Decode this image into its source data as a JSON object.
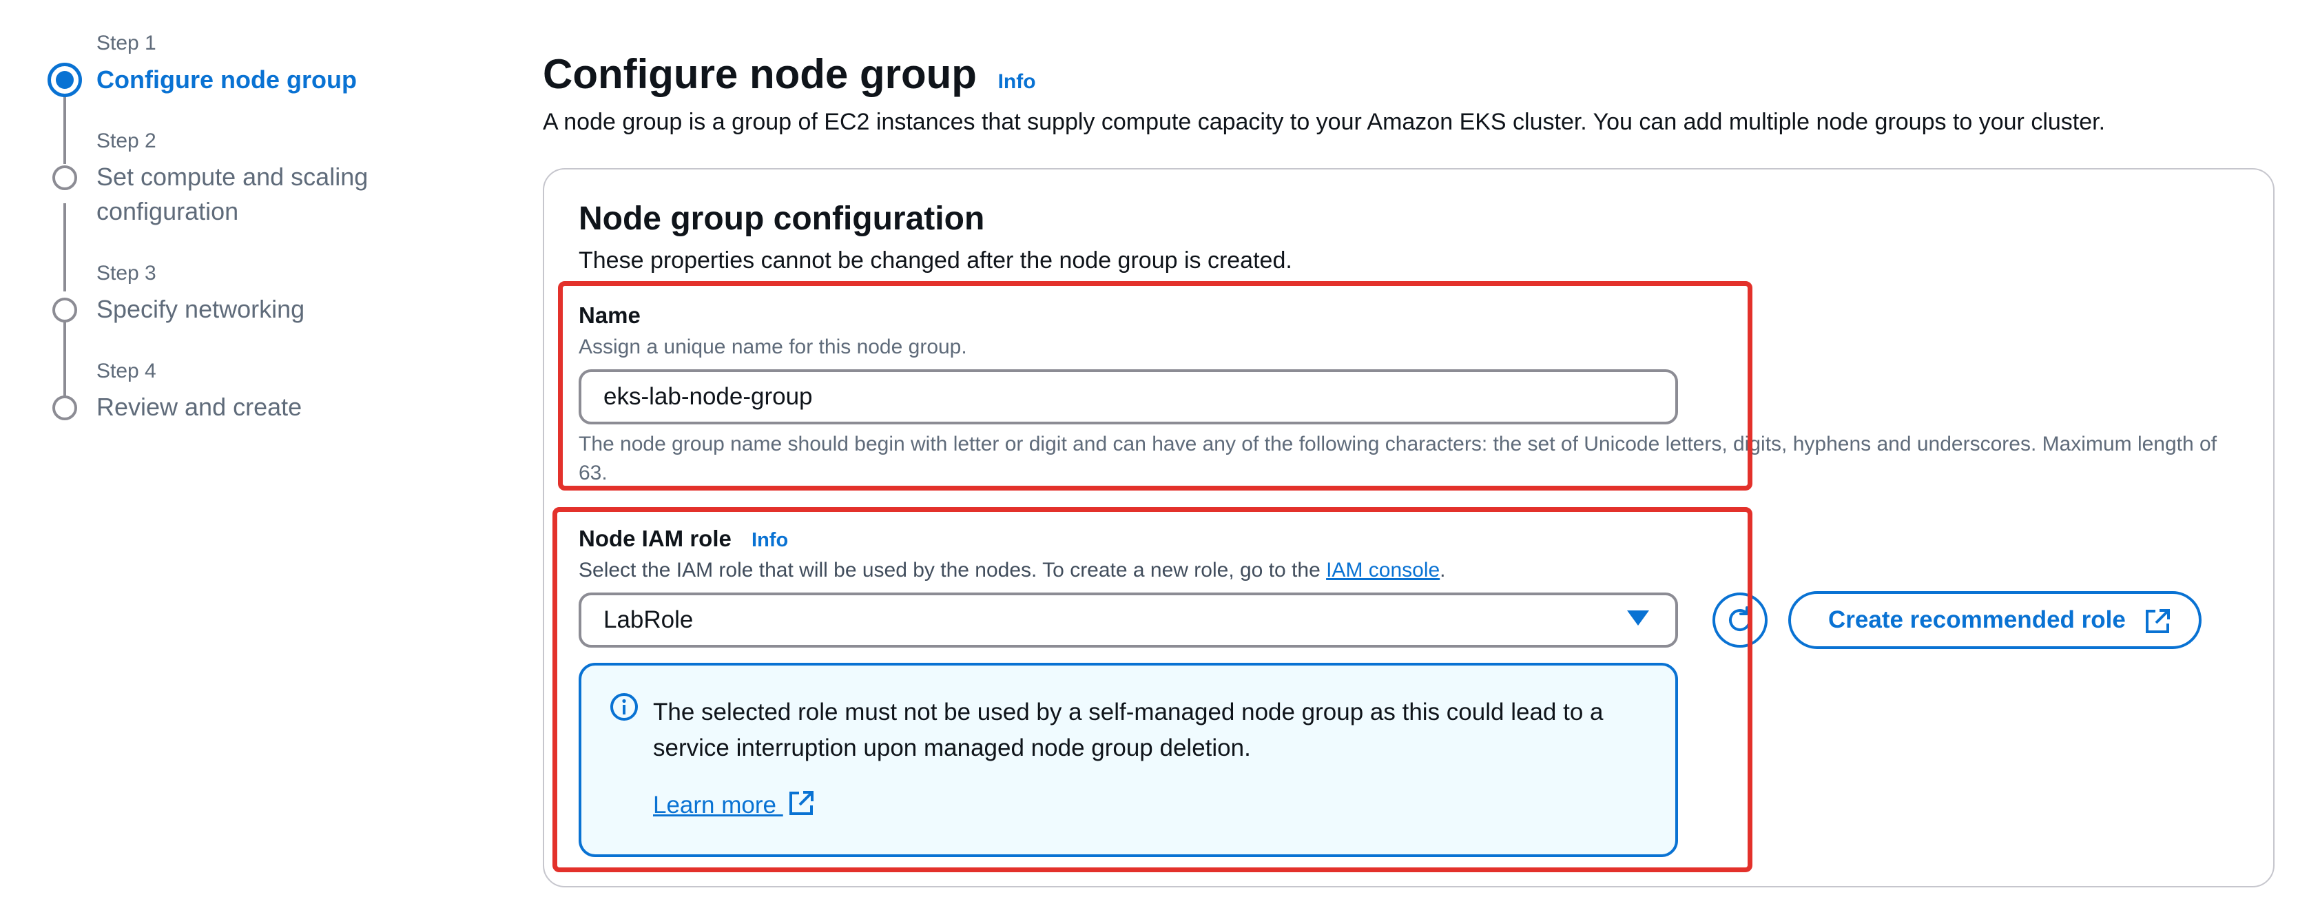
{
  "steps": [
    {
      "label": "Step 1",
      "title": "Configure node group",
      "active": true
    },
    {
      "label": "Step 2",
      "title": "Set compute and scaling configuration",
      "active": false
    },
    {
      "label": "Step 3",
      "title": "Specify networking",
      "active": false
    },
    {
      "label": "Step 4",
      "title": "Review and create",
      "active": false
    }
  ],
  "header": {
    "title": "Configure node group",
    "info": "Info",
    "description": "A node group is a group of EC2 instances that supply compute capacity to your Amazon EKS cluster. You can add multiple node groups to your cluster."
  },
  "section": {
    "title": "Node group configuration",
    "description": "These properties cannot be changed after the node group is created."
  },
  "name_field": {
    "label": "Name",
    "description": "Assign a unique name for this node group.",
    "value": "eks-lab-node-group",
    "constraint": "The node group name should begin with letter or digit and can have any of the following characters: the set of Unicode letters, digits, hyphens and underscores. Maximum length of 63."
  },
  "role_field": {
    "label": "Node IAM role",
    "info": "Info",
    "description_prefix": "Select the IAM role that will be used by the nodes. To create a new role, go to the ",
    "description_link": "IAM console",
    "description_suffix": ".",
    "selected": "LabRole",
    "create_button": "Create recommended role"
  },
  "alert": {
    "text": "The selected role must not be used by a self-managed node group as this could lead to a service interruption upon managed node group deletion.",
    "link": "Learn more"
  },
  "colors": {
    "accent": "#0972d3",
    "highlight": "#e3312b",
    "alert_bg": "#f0fbff"
  }
}
